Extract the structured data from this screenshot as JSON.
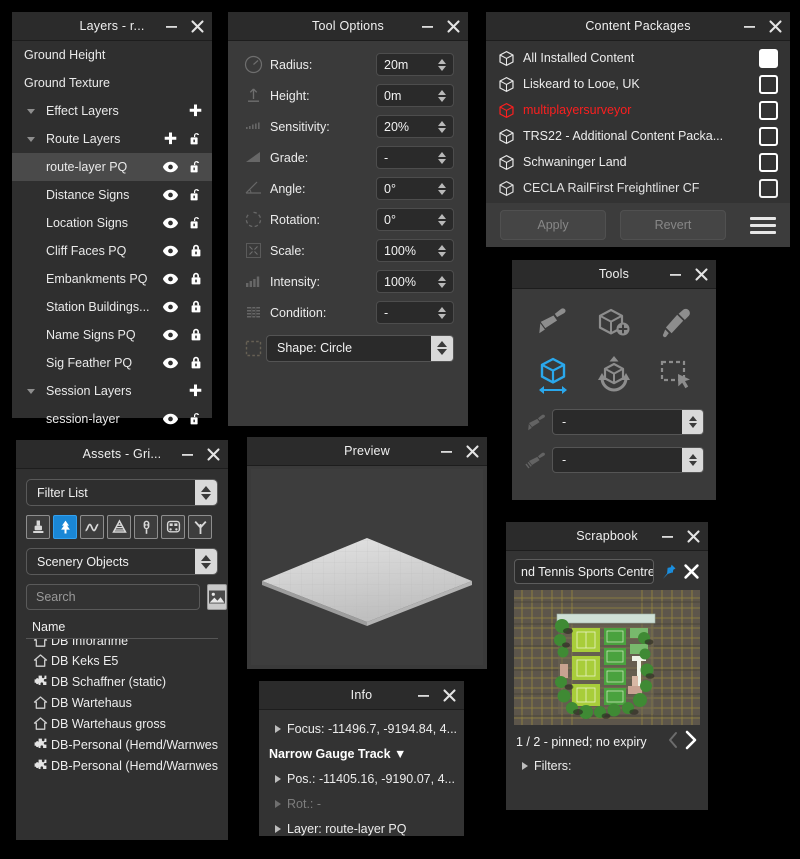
{
  "layers_panel": {
    "title": "Layers - r...",
    "minimize_icon": "minimize-icon",
    "close_icon": "close-icon",
    "rows": [
      {
        "label": "Ground Height",
        "type": "plain",
        "icons": []
      },
      {
        "label": "Ground Texture",
        "type": "plain",
        "icons": []
      },
      {
        "label": "Effect Layers",
        "type": "group",
        "icons": [
          "plus-icon"
        ]
      },
      {
        "label": "Route Layers",
        "type": "group",
        "icons": [
          "plus-icon",
          "unlock-icon"
        ]
      },
      {
        "label": "route-layer PQ",
        "type": "item",
        "selected": true,
        "icons": [
          "eye-icon",
          "unlock-icon"
        ]
      },
      {
        "label": "Distance Signs",
        "type": "item",
        "icons": [
          "eye-icon",
          "unlock-icon"
        ]
      },
      {
        "label": "Location Signs",
        "type": "item",
        "icons": [
          "eye-icon",
          "unlock-icon"
        ]
      },
      {
        "label": "Cliff Faces PQ",
        "type": "item",
        "icons": [
          "eye-icon",
          "lock-icon"
        ]
      },
      {
        "label": "Embankments PQ",
        "type": "item",
        "icons": [
          "eye-icon",
          "lock-icon"
        ]
      },
      {
        "label": "Station Buildings...",
        "type": "item",
        "icons": [
          "eye-icon",
          "lock-icon"
        ]
      },
      {
        "label": "Name Signs PQ",
        "type": "item",
        "icons": [
          "eye-icon",
          "lock-icon"
        ]
      },
      {
        "label": "Sig Feather PQ",
        "type": "item",
        "icons": [
          "eye-icon",
          "lock-icon"
        ]
      },
      {
        "label": "Session Layers",
        "type": "group",
        "icons": [
          "plus-icon"
        ]
      },
      {
        "label": "session-layer",
        "type": "item",
        "icons": [
          "eye-icon",
          "unlock-icon"
        ]
      }
    ]
  },
  "tool_options": {
    "title": "Tool Options",
    "rows": [
      {
        "icon": "radius-icon",
        "label": "Radius:",
        "value": "20m"
      },
      {
        "icon": "height-arrow-icon",
        "label": "Height:",
        "value": "0m"
      },
      {
        "icon": "sensitivity-icon",
        "label": "Sensitivity:",
        "value": "20%"
      },
      {
        "icon": "grade-icon",
        "label": "Grade:",
        "value": "-"
      },
      {
        "icon": "angle-icon",
        "label": "Angle:",
        "value": "0°"
      },
      {
        "icon": "rotation-icon",
        "label": "Rotation:",
        "value": "0°"
      },
      {
        "icon": "scale-icon",
        "label": "Scale:",
        "value": "100%"
      },
      {
        "icon": "intensity-icon",
        "label": "Intensity:",
        "value": "100%"
      },
      {
        "icon": "condition-icon",
        "label": "Condition:",
        "value": "-"
      }
    ],
    "shape": {
      "icon": "shape-icon",
      "value": "Shape: Circle"
    }
  },
  "content_packages": {
    "title": "Content Packages",
    "items": [
      {
        "name": "All Installed Content",
        "checked": true,
        "error": false
      },
      {
        "name": "Liskeard to Looe, UK",
        "checked": false,
        "error": false
      },
      {
        "name": "multiplayersurveyor",
        "checked": false,
        "error": true
      },
      {
        "name": "TRS22 - Additional Content Packa...",
        "checked": false,
        "error": false
      },
      {
        "name": "Schwaninger Land",
        "checked": false,
        "error": false
      },
      {
        "name": "CECLA RailFirst Freightliner CF",
        "checked": false,
        "error": false
      }
    ],
    "apply_label": "Apply",
    "revert_label": "Revert",
    "menu_icon": "hamburger-menu-icon",
    "error_color": "#fb1f1f"
  },
  "tools": {
    "title": "Tools",
    "buttons": [
      {
        "icon": "paint-brush-icon",
        "active": false
      },
      {
        "icon": "add-object-icon",
        "active": false
      },
      {
        "icon": "eyedropper-icon",
        "active": false
      },
      {
        "icon": "move-object-icon",
        "active": true
      },
      {
        "icon": "rotate-object-icon",
        "active": false
      },
      {
        "icon": "marquee-select-icon",
        "active": false
      }
    ],
    "selects": [
      {
        "icon": "brush-small-icon",
        "value": "-"
      },
      {
        "icon": "brush-large-icon",
        "value": "-"
      }
    ],
    "accent_color": "#2aa8ec"
  },
  "assets": {
    "title": "Assets - Gri...",
    "filter_list_value": "Filter List",
    "category_value": "Scenery Objects",
    "search_placeholder": "Search",
    "search_value": "",
    "thumbnail_toggle_icon": "image-thumbnail-icon",
    "filter_icons": [
      {
        "icon": "texture-brush-icon",
        "active": false
      },
      {
        "icon": "scenery-tree-icon",
        "active": true
      },
      {
        "icon": "track-spline-icon",
        "active": false
      },
      {
        "icon": "bridge-icon",
        "active": false
      },
      {
        "icon": "signal-icon",
        "active": false
      },
      {
        "icon": "train-icon",
        "active": false
      },
      {
        "icon": "grass-icon",
        "active": false
      }
    ],
    "column_header": "Name",
    "rows": [
      {
        "icon": "house-icon",
        "name": "DB Inforahme"
      },
      {
        "icon": "house-icon",
        "name": "DB Keks E5"
      },
      {
        "icon": "puzzle-icon",
        "name": "DB Schaffner (static)"
      },
      {
        "icon": "house-icon",
        "name": "DB Wartehaus"
      },
      {
        "icon": "house-icon",
        "name": "DB Wartehaus gross"
      },
      {
        "icon": "puzzle-icon",
        "name": "DB-Personal (Hemd/Warnweste)"
      },
      {
        "icon": "puzzle-icon",
        "name": "DB-Personal (Hemd/Warnweste)"
      }
    ]
  },
  "preview": {
    "title": "Preview"
  },
  "info": {
    "title": "Info",
    "rows": [
      {
        "kind": "expandable",
        "text": "Focus: -11496.7, -9194.84, 4...",
        "dim": false
      },
      {
        "kind": "header",
        "text": "Narrow Gauge Track ▼"
      },
      {
        "kind": "expandable",
        "text": "Pos.: -11405.16, -9190.07, 4...",
        "dim": false
      },
      {
        "kind": "expandable",
        "text": "Rot.: -",
        "dim": true
      },
      {
        "kind": "expandable",
        "text": "Layer: route-layer PQ",
        "dim": false
      }
    ]
  },
  "scrapbook": {
    "title": "Scrapbook",
    "entry_name": "nd Tennis Sports Centre",
    "pin_icon": "pin-icon",
    "remove_icon": "close-icon",
    "status": "1 / 2  - pinned; no expiry",
    "prev_icon": "chevron-left-icon",
    "next_icon": "chevron-right-icon",
    "filters_label": "Filters:",
    "pin_color": "#1a8fe0"
  }
}
